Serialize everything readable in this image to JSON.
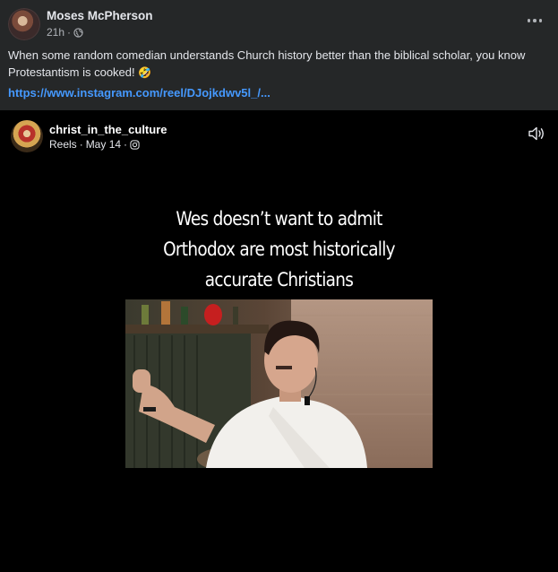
{
  "post": {
    "author": "Moses McPherson",
    "time": "21h",
    "text": "When some random comedian understands Church history better than the biblical scholar, you know Protestantism is cooked!",
    "emoji": "🤣",
    "link": "https://www.instagram.com/reel/DJojkdwv5l_/..."
  },
  "reel": {
    "account": "christ_in_the_culture",
    "type_label": "Reels",
    "date": "May 14",
    "caption_lines": [
      "Wes doesn’t want to admit",
      "Orthodox are most historically",
      "accurate Christians"
    ]
  },
  "icons": {
    "privacy": "globe-icon",
    "menu": "more-options-icon",
    "source": "instagram-icon",
    "audio": "speaker-icon"
  },
  "colors": {
    "background": "#252728",
    "link": "#4599ff",
    "reel_background": "#000000"
  }
}
